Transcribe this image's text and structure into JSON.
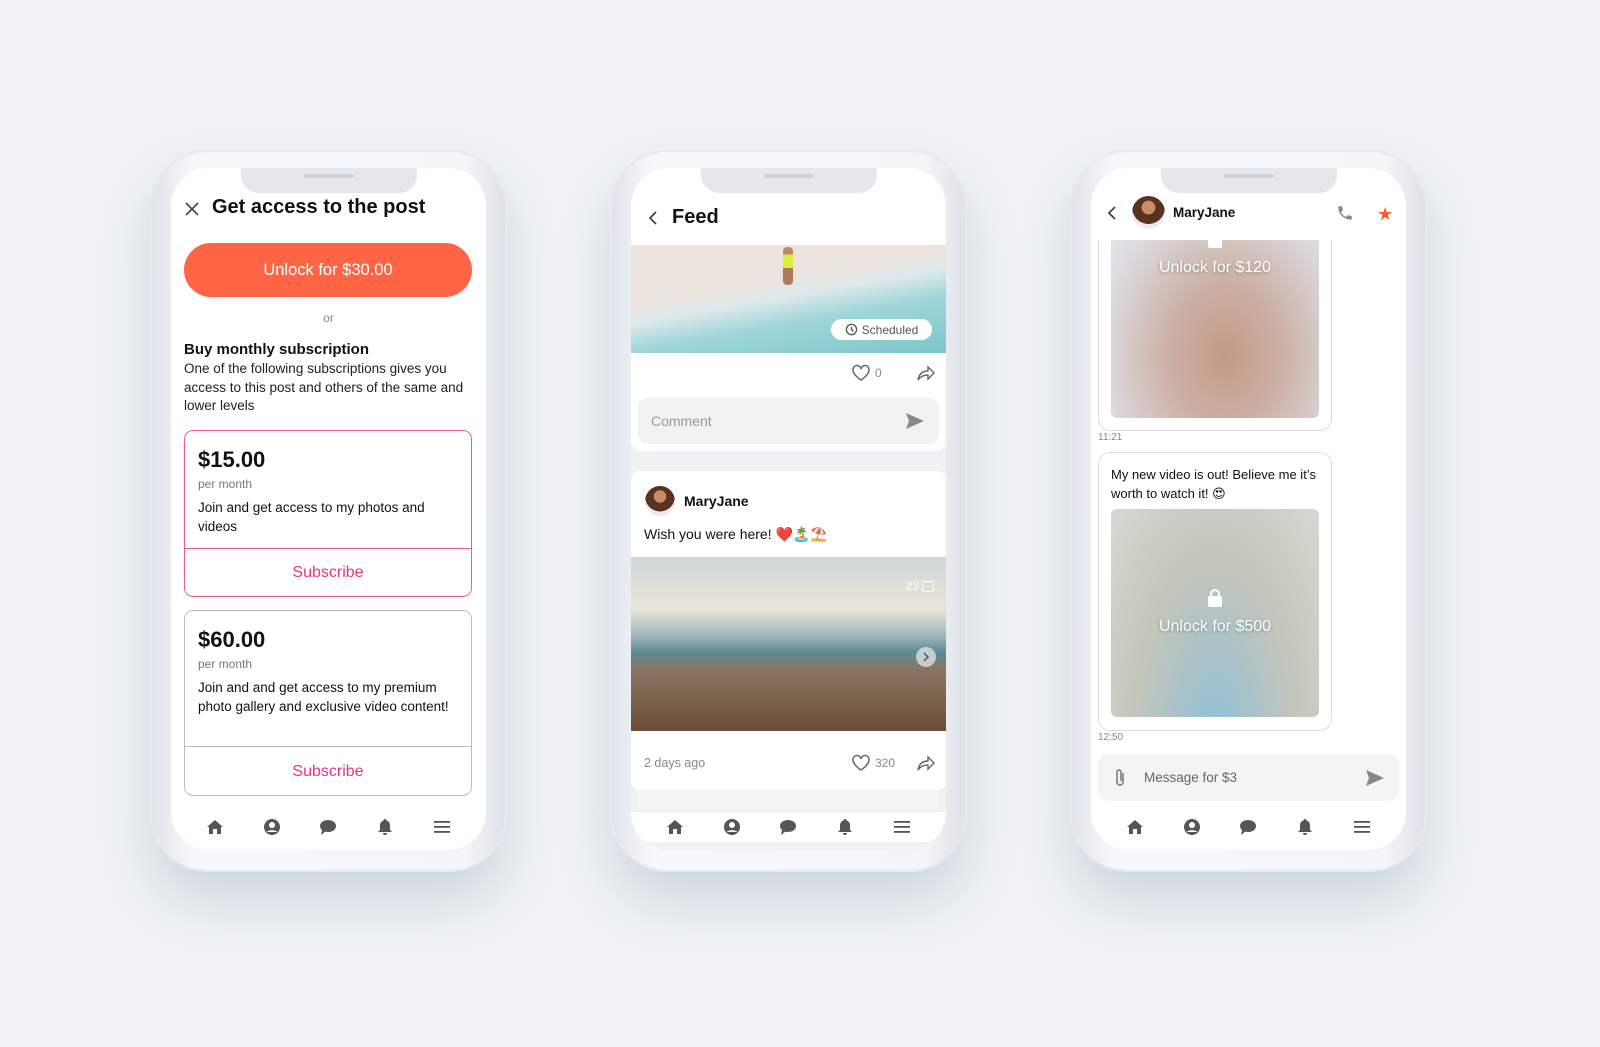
{
  "access_screen": {
    "title": "Get access to the post",
    "unlock_button": "Unlock for $30.00",
    "or_label": "or",
    "subscription_heading": "Buy monthly subscription",
    "subscription_description": "One of the following subscriptions gives you access to this post and others of the same and lower levels",
    "plans": [
      {
        "price": "$15.00",
        "period": "per month",
        "description": "Join and get access to my photos and videos",
        "button": "Subscribe"
      },
      {
        "price": "$60.00",
        "period": "per month",
        "description": "Join and and get access to my premium photo gallery and exclusive video content!",
        "button": "Subscribe"
      }
    ],
    "accent": "#FF6544"
  },
  "feed_screen": {
    "title": "Feed",
    "scheduled_label": "Scheduled",
    "post1_likes": "0",
    "comment_placeholder": "Comment",
    "post2": {
      "author": "MaryJane",
      "text": "Wish you were here! ❤️🏝️⛱️",
      "photo_count": "23",
      "time": "2 days ago",
      "likes": "320"
    }
  },
  "chat_screen": {
    "contact": "MaryJane",
    "messages": [
      {
        "locked_label": "Unlock for $120",
        "time": "11:21"
      },
      {
        "text": "My new video is out! Believe me it’s worth to watch it! 😍",
        "locked_label": "Unlock for $500",
        "time": "12:50"
      }
    ],
    "message_placeholder": "Message for $3",
    "star_color": "#FF5A36"
  },
  "nav_icons": [
    "home-icon",
    "profile-icon",
    "chat-icon",
    "bell-icon",
    "menu-icon"
  ]
}
